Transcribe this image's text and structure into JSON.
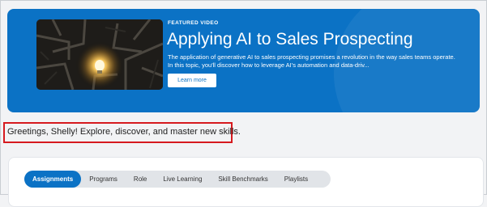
{
  "hero": {
    "kicker": "FEATURED VIDEO",
    "title": "Applying AI to Sales Prospecting",
    "description": "The application of generative AI to sales prospecting promises a revolution in the way sales teams operate. In this topic, you'll discover how to leverage AI's automation and data-driv...",
    "button_label": "Learn more",
    "thumbnail_icon": "maze-lightbulb-image"
  },
  "greeting": "Greetings, Shelly! Explore, discover, and master new skills.",
  "tabs": [
    {
      "label": "Assignments",
      "active": true
    },
    {
      "label": "Programs",
      "active": false
    },
    {
      "label": "Role",
      "active": false
    },
    {
      "label": "Live Learning",
      "active": false
    },
    {
      "label": "Skill Benchmarks",
      "active": false
    },
    {
      "label": "Playlists",
      "active": false
    }
  ],
  "colors": {
    "hero_background": "#0b72c5",
    "active_tab": "#0b72c5",
    "highlight_border": "#d61a1f"
  }
}
